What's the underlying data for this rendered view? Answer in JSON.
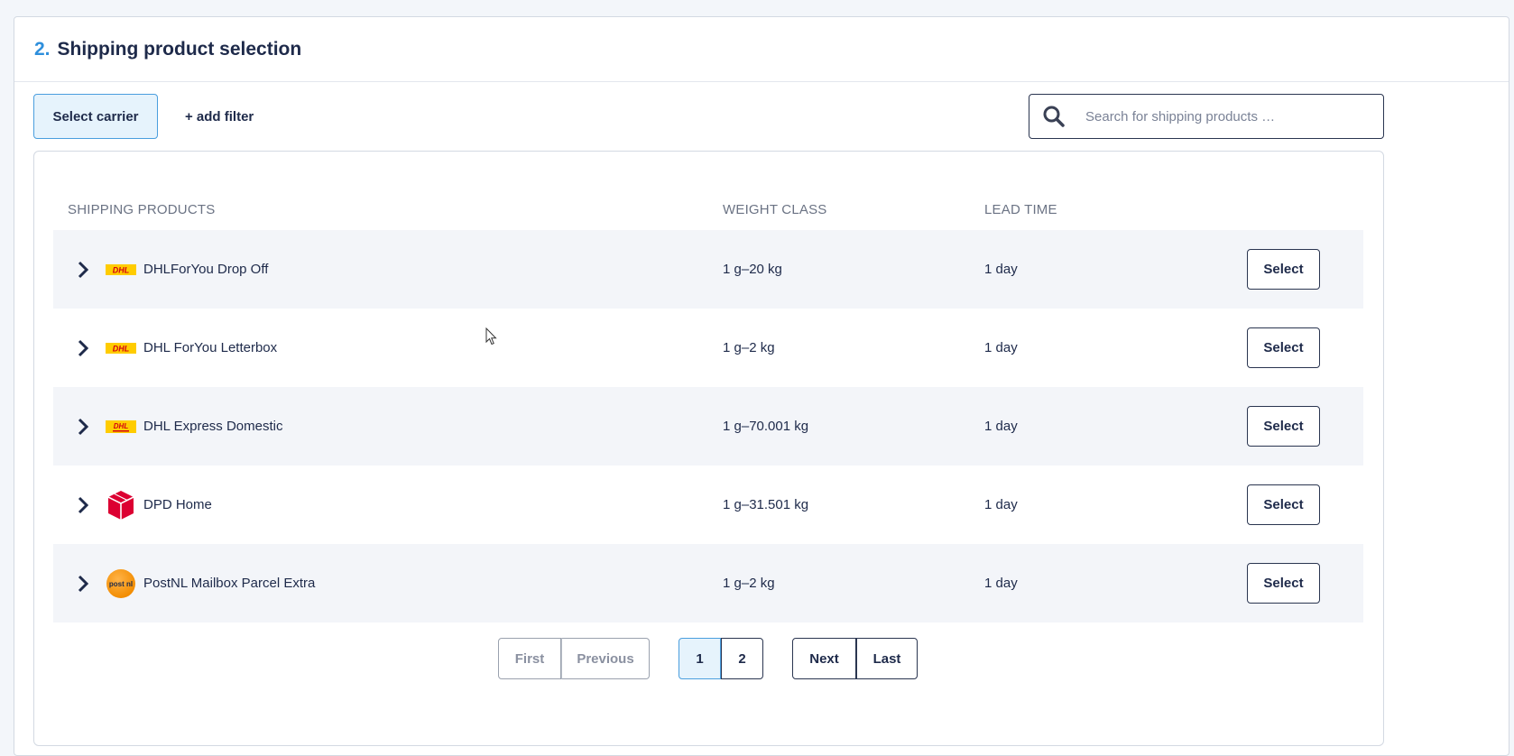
{
  "header": {
    "step_number": "2.",
    "title": "Shipping product selection"
  },
  "toolbar": {
    "carrier_button": "Select carrier",
    "add_filter": "+ add filter",
    "search_placeholder": "Search for shipping products …"
  },
  "table": {
    "columns": [
      "SHIPPING PRODUCTS",
      "WEIGHT CLASS",
      "LEAD TIME"
    ],
    "rows": [
      {
        "name": "DHLForYou Drop Off",
        "carrier": "dhl",
        "weight": "1 g–20 kg",
        "lead": "1 day",
        "action": "Select"
      },
      {
        "name": "DHL ForYou Letterbox",
        "carrier": "dhl",
        "weight": "1 g–2 kg",
        "lead": "1 day",
        "action": "Select"
      },
      {
        "name": "DHL Express Domestic",
        "carrier": "dhl-express",
        "weight": "1 g–70.001 kg",
        "lead": "1 day",
        "action": "Select"
      },
      {
        "name": "DPD Home",
        "carrier": "dpd",
        "weight": "1 g–31.501 kg",
        "lead": "1 day",
        "action": "Select"
      },
      {
        "name": "PostNL Mailbox Parcel Extra",
        "carrier": "postnl",
        "weight": "1 g–2 kg",
        "lead": "1 day",
        "action": "Select"
      }
    ]
  },
  "pagination": {
    "first": "First",
    "previous": "Previous",
    "pages": [
      "1",
      "2"
    ],
    "current_page": "1",
    "next": "Next",
    "last": "Last"
  },
  "colors": {
    "accent": "#2e8fdc",
    "text": "#1e2a4a",
    "row_alt": "#f3f5f9",
    "dhl_yellow": "#ffcc00",
    "dhl_red": "#d40511",
    "dpd_red": "#dc0032",
    "postnl_orange": "#f28c00"
  },
  "logos": {
    "dhl": "DHL",
    "postnl": "post nl"
  }
}
